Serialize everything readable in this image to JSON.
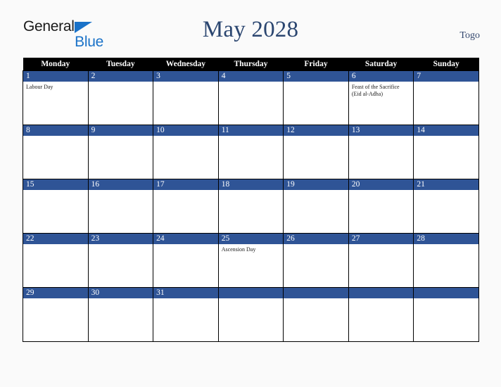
{
  "brand": {
    "word1": "General",
    "word2": "Blue",
    "triangle_color": "#1a72c8",
    "word1_color": "#1a1a1a",
    "word2_color": "#1a72c8"
  },
  "header": {
    "title": "May 2028",
    "country": "Togo",
    "title_color": "#2b4670"
  },
  "calendar": {
    "weekday_headers": [
      "Monday",
      "Tuesday",
      "Wednesday",
      "Thursday",
      "Friday",
      "Saturday",
      "Sunday"
    ],
    "header_bg": "#000000",
    "daynum_bg": "#2f5496",
    "weeks": [
      [
        {
          "day": "1",
          "event": "Labour Day"
        },
        {
          "day": "2",
          "event": ""
        },
        {
          "day": "3",
          "event": ""
        },
        {
          "day": "4",
          "event": ""
        },
        {
          "day": "5",
          "event": ""
        },
        {
          "day": "6",
          "event": "Feast of the Sacrifice (Eid al-Adha)"
        },
        {
          "day": "7",
          "event": ""
        }
      ],
      [
        {
          "day": "8",
          "event": ""
        },
        {
          "day": "9",
          "event": ""
        },
        {
          "day": "10",
          "event": ""
        },
        {
          "day": "11",
          "event": ""
        },
        {
          "day": "12",
          "event": ""
        },
        {
          "day": "13",
          "event": ""
        },
        {
          "day": "14",
          "event": ""
        }
      ],
      [
        {
          "day": "15",
          "event": ""
        },
        {
          "day": "16",
          "event": ""
        },
        {
          "day": "17",
          "event": ""
        },
        {
          "day": "18",
          "event": ""
        },
        {
          "day": "19",
          "event": ""
        },
        {
          "day": "20",
          "event": ""
        },
        {
          "day": "21",
          "event": ""
        }
      ],
      [
        {
          "day": "22",
          "event": ""
        },
        {
          "day": "23",
          "event": ""
        },
        {
          "day": "24",
          "event": ""
        },
        {
          "day": "25",
          "event": "Ascension Day"
        },
        {
          "day": "26",
          "event": ""
        },
        {
          "day": "27",
          "event": ""
        },
        {
          "day": "28",
          "event": ""
        }
      ],
      [
        {
          "day": "29",
          "event": ""
        },
        {
          "day": "30",
          "event": ""
        },
        {
          "day": "31",
          "event": ""
        },
        {
          "day": "",
          "event": ""
        },
        {
          "day": "",
          "event": ""
        },
        {
          "day": "",
          "event": ""
        },
        {
          "day": "",
          "event": ""
        }
      ]
    ]
  }
}
